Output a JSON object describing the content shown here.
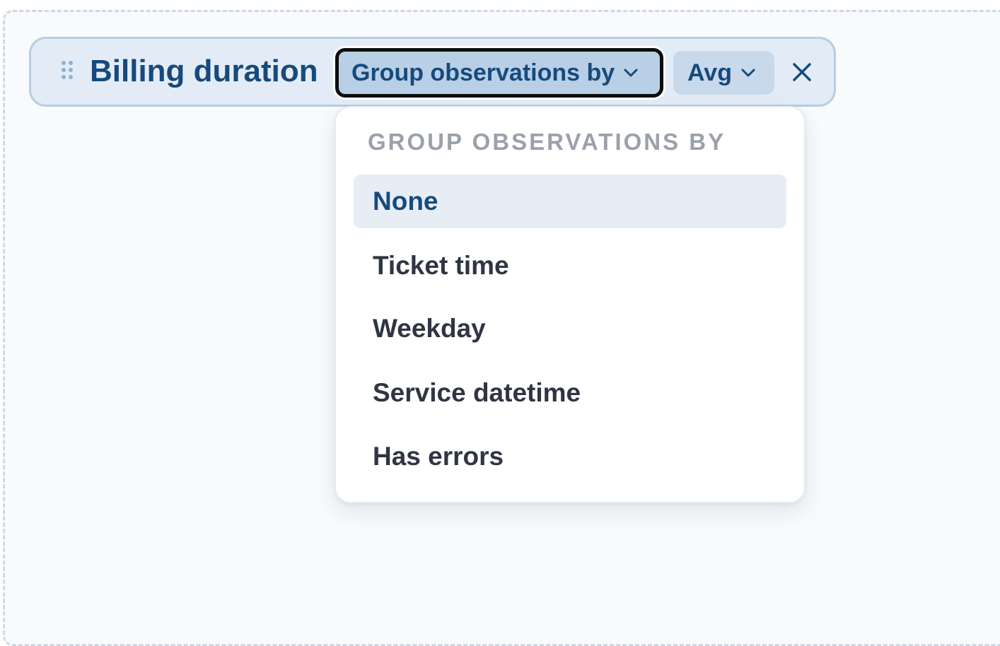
{
  "metric": {
    "title": "Billing duration"
  },
  "group_button": {
    "label": "Group observations by"
  },
  "aggregation_button": {
    "label": "Avg"
  },
  "dropdown": {
    "header": "GROUP OBSERVATIONS BY",
    "options": [
      {
        "label": "None",
        "selected": true
      },
      {
        "label": "Ticket time",
        "selected": false
      },
      {
        "label": "Weekday",
        "selected": false
      },
      {
        "label": "Service datetime",
        "selected": false
      },
      {
        "label": "Has errors",
        "selected": false
      }
    ]
  },
  "colors": {
    "accent_text": "#174a7c",
    "pill_background": "#e3ecf6",
    "pill_border": "#b7cde2",
    "selected_button": "#b8cfe5",
    "focus_ring": "#0d0d0d",
    "selected_option_background": "#e6edf5",
    "header_text": "#9aa1ab",
    "option_text": "#2f3542"
  },
  "icons": {
    "drag": "drag-handle-icon",
    "chevron": "chevron-down-icon",
    "close": "close-icon"
  }
}
